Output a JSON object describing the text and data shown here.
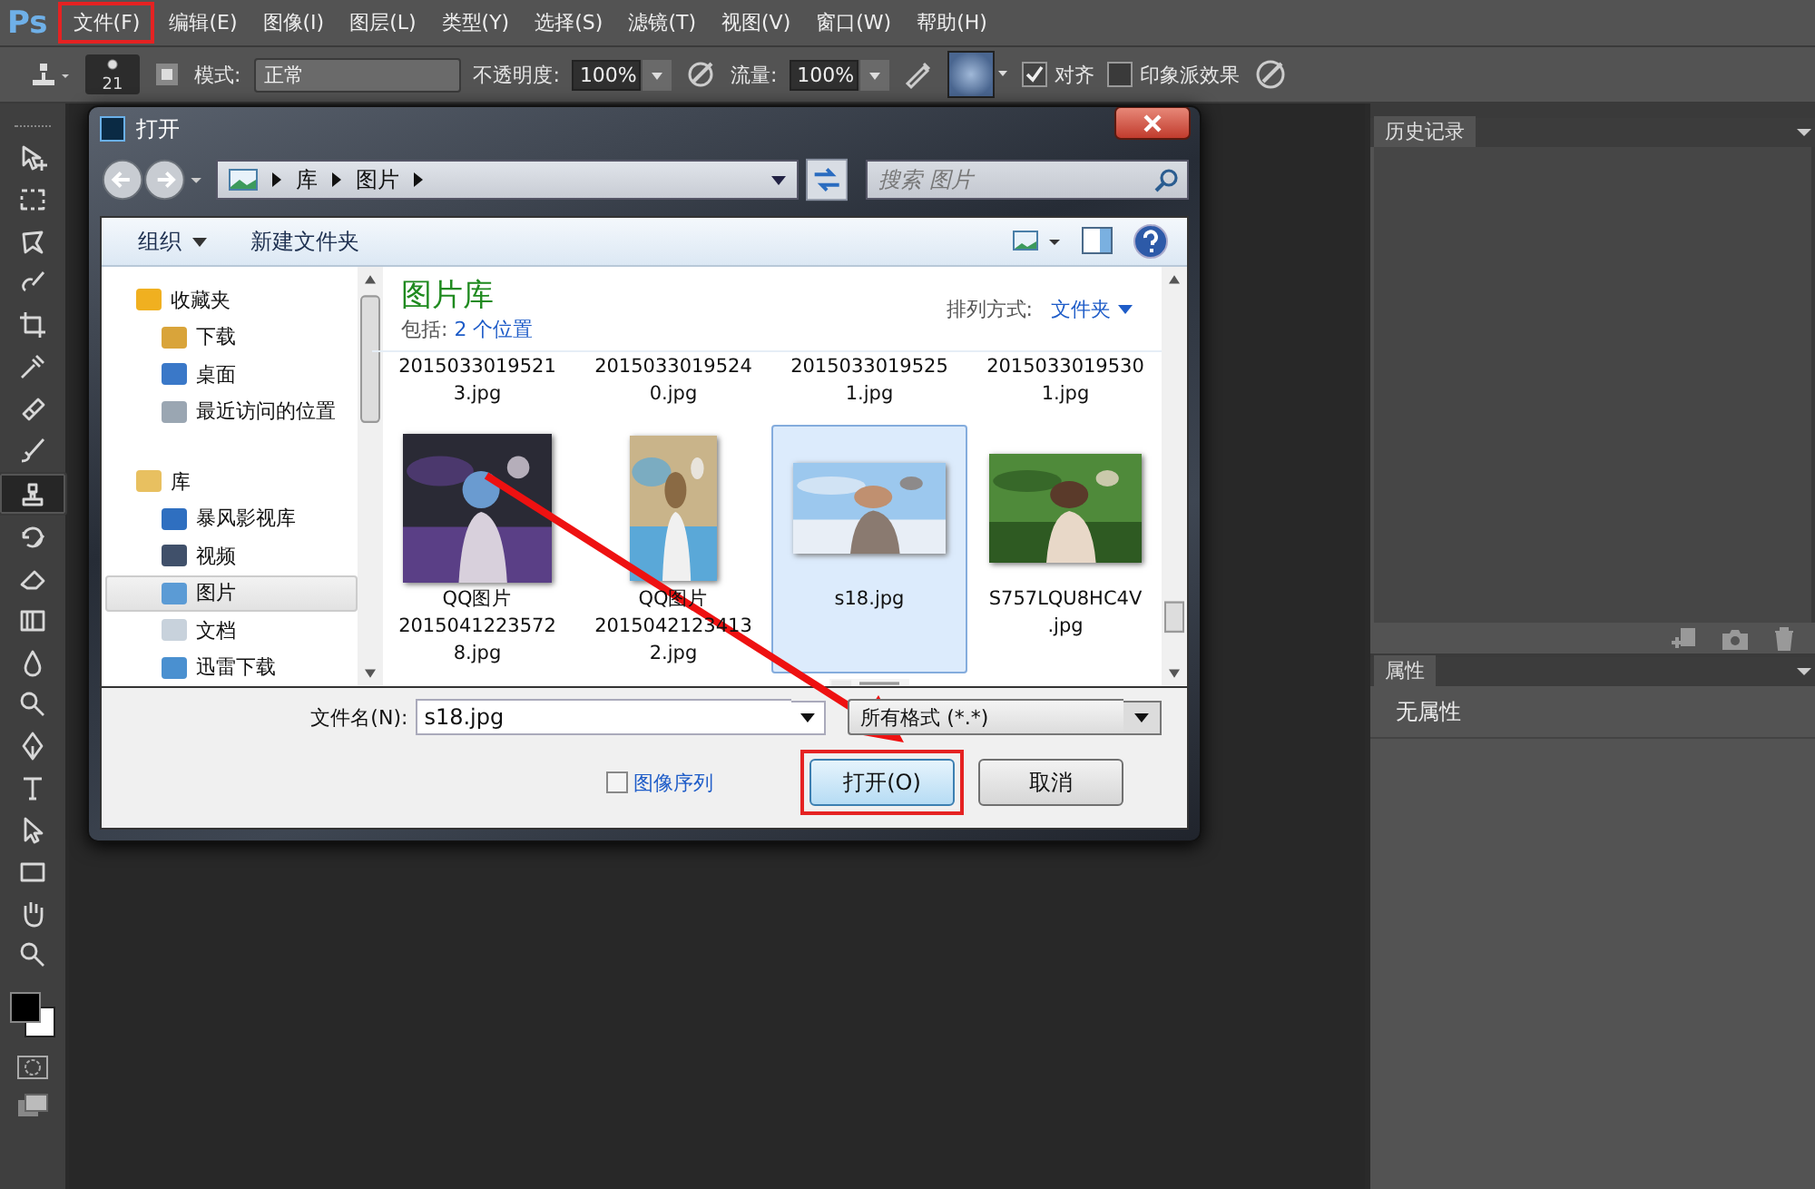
{
  "app": {
    "logo": "Ps"
  },
  "menu": [
    {
      "label": "文件(F)",
      "highlighted": true
    },
    {
      "label": "编辑(E)",
      "highlighted": false
    },
    {
      "label": "图像(I)",
      "highlighted": false
    },
    {
      "label": "图层(L)",
      "highlighted": false
    },
    {
      "label": "类型(Y)",
      "highlighted": false
    },
    {
      "label": "选择(S)",
      "highlighted": false
    },
    {
      "label": "滤镜(T)",
      "highlighted": false
    },
    {
      "label": "视图(V)",
      "highlighted": false
    },
    {
      "label": "窗口(W)",
      "highlighted": false
    },
    {
      "label": "帮助(H)",
      "highlighted": false
    }
  ],
  "options_bar": {
    "brush_size": "21",
    "mode_label": "模式:",
    "mode": "正常",
    "opacity_label": "不透明度:",
    "opacity": "100%",
    "flow_label": "流量:",
    "flow": "100%",
    "checkboxes": [
      {
        "label": "对齐",
        "checked": true
      },
      {
        "label": "印象派效果",
        "checked": false
      }
    ]
  },
  "tools": [
    {
      "kind": "move",
      "selected": false
    },
    {
      "kind": "marquee",
      "selected": false
    },
    {
      "kind": "lasso",
      "selected": false
    },
    {
      "kind": "quick-select",
      "selected": false
    },
    {
      "kind": "crop",
      "selected": false
    },
    {
      "kind": "eyedropper",
      "selected": false
    },
    {
      "kind": "heal",
      "selected": false
    },
    {
      "kind": "brush",
      "selected": false
    },
    {
      "kind": "stamp",
      "selected": true
    },
    {
      "kind": "history-brush",
      "selected": false
    },
    {
      "kind": "eraser",
      "selected": false
    },
    {
      "kind": "gradient",
      "selected": false
    },
    {
      "kind": "blur",
      "selected": false
    },
    {
      "kind": "dodge",
      "selected": false
    },
    {
      "kind": "pen",
      "selected": false
    },
    {
      "kind": "type",
      "selected": false
    },
    {
      "kind": "path-select",
      "selected": false
    },
    {
      "kind": "shape",
      "selected": false
    },
    {
      "kind": "hand",
      "selected": false
    },
    {
      "kind": "zoom",
      "selected": false
    }
  ],
  "dialog": {
    "title": "打开",
    "breadcrumb": [
      "库",
      "图片"
    ],
    "search_placeholder": "搜索 图片",
    "toolbar": {
      "organize": "组织",
      "new_folder": "新建文件夹"
    },
    "nav": [
      {
        "label": "收藏夹",
        "kind": "favorites",
        "selected": false,
        "children": [
          {
            "label": "下载",
            "kind": "download",
            "selected": false
          },
          {
            "label": "桌面",
            "kind": "desktop",
            "selected": false
          },
          {
            "label": "最近访问的位置",
            "kind": "recent",
            "selected": false
          }
        ]
      },
      {
        "label": "库",
        "kind": "library",
        "selected": false,
        "children": [
          {
            "label": "暴风影视库",
            "kind": "video-lib",
            "selected": false
          },
          {
            "label": "视频",
            "kind": "video",
            "selected": false
          },
          {
            "label": "图片",
            "kind": "pictures",
            "selected": true
          },
          {
            "label": "文档",
            "kind": "docs",
            "selected": false
          },
          {
            "label": "迅雷下载",
            "kind": "download-lib",
            "selected": false
          }
        ]
      }
    ],
    "library": {
      "title": "图片库",
      "includes_label": "包括:",
      "includes_link": "2 个位置",
      "arrange_label": "排列方式:",
      "arrange_value": "文件夹"
    },
    "files": [
      {
        "kind": "name",
        "lines": [
          "2015033019521",
          "3.jpg"
        ],
        "selected": false
      },
      {
        "kind": "name",
        "lines": [
          "2015033019524",
          "0.jpg"
        ],
        "selected": false
      },
      {
        "kind": "name",
        "lines": [
          "2015033019525",
          "1.jpg"
        ],
        "selected": false
      },
      {
        "kind": "name",
        "lines": [
          "2015033019530",
          "1.jpg"
        ],
        "selected": false
      },
      {
        "kind": "picture",
        "lines": [
          "QQ图片",
          "2015041223572",
          "8.jpg"
        ],
        "selected": false
      },
      {
        "kind": "picture",
        "lines": [
          "QQ图片",
          "2015042123413",
          "2.jpg"
        ],
        "selected": false
      },
      {
        "kind": "picture",
        "lines": [
          "s18.jpg"
        ],
        "selected": true
      },
      {
        "kind": "picture",
        "lines": [
          "S757LQU8HC4V",
          ".jpg"
        ],
        "selected": false
      },
      {
        "kind": "peek",
        "selected": false
      }
    ],
    "filename_label": "文件名(N):",
    "filename": "s18.jpg",
    "filetype": "所有格式 (*.*)",
    "sequence": {
      "label": "图像序列",
      "checked": false
    },
    "buttons": [
      {
        "label": "打开(O)",
        "kind": "primary",
        "highlighted": true
      },
      {
        "label": "取消",
        "kind": "cancel",
        "highlighted": false
      }
    ]
  },
  "panels": {
    "history": {
      "tab": "历史记录"
    },
    "properties": {
      "tab": "属性",
      "text": "无属性"
    }
  },
  "annotation": {
    "arrow": true
  }
}
